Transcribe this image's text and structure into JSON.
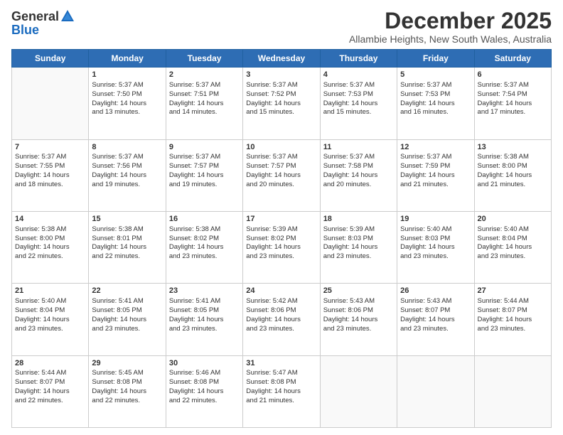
{
  "logo": {
    "general": "General",
    "blue": "Blue"
  },
  "header": {
    "month": "December 2025",
    "location": "Allambie Heights, New South Wales, Australia"
  },
  "days": [
    "Sunday",
    "Monday",
    "Tuesday",
    "Wednesday",
    "Thursday",
    "Friday",
    "Saturday"
  ],
  "weeks": [
    [
      {
        "day": "",
        "content": ""
      },
      {
        "day": "1",
        "content": "Sunrise: 5:37 AM\nSunset: 7:50 PM\nDaylight: 14 hours\nand 13 minutes."
      },
      {
        "day": "2",
        "content": "Sunrise: 5:37 AM\nSunset: 7:51 PM\nDaylight: 14 hours\nand 14 minutes."
      },
      {
        "day": "3",
        "content": "Sunrise: 5:37 AM\nSunset: 7:52 PM\nDaylight: 14 hours\nand 15 minutes."
      },
      {
        "day": "4",
        "content": "Sunrise: 5:37 AM\nSunset: 7:53 PM\nDaylight: 14 hours\nand 15 minutes."
      },
      {
        "day": "5",
        "content": "Sunrise: 5:37 AM\nSunset: 7:53 PM\nDaylight: 14 hours\nand 16 minutes."
      },
      {
        "day": "6",
        "content": "Sunrise: 5:37 AM\nSunset: 7:54 PM\nDaylight: 14 hours\nand 17 minutes."
      }
    ],
    [
      {
        "day": "7",
        "content": "Sunrise: 5:37 AM\nSunset: 7:55 PM\nDaylight: 14 hours\nand 18 minutes."
      },
      {
        "day": "8",
        "content": "Sunrise: 5:37 AM\nSunset: 7:56 PM\nDaylight: 14 hours\nand 19 minutes."
      },
      {
        "day": "9",
        "content": "Sunrise: 5:37 AM\nSunset: 7:57 PM\nDaylight: 14 hours\nand 19 minutes."
      },
      {
        "day": "10",
        "content": "Sunrise: 5:37 AM\nSunset: 7:57 PM\nDaylight: 14 hours\nand 20 minutes."
      },
      {
        "day": "11",
        "content": "Sunrise: 5:37 AM\nSunset: 7:58 PM\nDaylight: 14 hours\nand 20 minutes."
      },
      {
        "day": "12",
        "content": "Sunrise: 5:37 AM\nSunset: 7:59 PM\nDaylight: 14 hours\nand 21 minutes."
      },
      {
        "day": "13",
        "content": "Sunrise: 5:38 AM\nSunset: 8:00 PM\nDaylight: 14 hours\nand 21 minutes."
      }
    ],
    [
      {
        "day": "14",
        "content": "Sunrise: 5:38 AM\nSunset: 8:00 PM\nDaylight: 14 hours\nand 22 minutes."
      },
      {
        "day": "15",
        "content": "Sunrise: 5:38 AM\nSunset: 8:01 PM\nDaylight: 14 hours\nand 22 minutes."
      },
      {
        "day": "16",
        "content": "Sunrise: 5:38 AM\nSunset: 8:02 PM\nDaylight: 14 hours\nand 23 minutes."
      },
      {
        "day": "17",
        "content": "Sunrise: 5:39 AM\nSunset: 8:02 PM\nDaylight: 14 hours\nand 23 minutes."
      },
      {
        "day": "18",
        "content": "Sunrise: 5:39 AM\nSunset: 8:03 PM\nDaylight: 14 hours\nand 23 minutes."
      },
      {
        "day": "19",
        "content": "Sunrise: 5:40 AM\nSunset: 8:03 PM\nDaylight: 14 hours\nand 23 minutes."
      },
      {
        "day": "20",
        "content": "Sunrise: 5:40 AM\nSunset: 8:04 PM\nDaylight: 14 hours\nand 23 minutes."
      }
    ],
    [
      {
        "day": "21",
        "content": "Sunrise: 5:40 AM\nSunset: 8:04 PM\nDaylight: 14 hours\nand 23 minutes."
      },
      {
        "day": "22",
        "content": "Sunrise: 5:41 AM\nSunset: 8:05 PM\nDaylight: 14 hours\nand 23 minutes."
      },
      {
        "day": "23",
        "content": "Sunrise: 5:41 AM\nSunset: 8:05 PM\nDaylight: 14 hours\nand 23 minutes."
      },
      {
        "day": "24",
        "content": "Sunrise: 5:42 AM\nSunset: 8:06 PM\nDaylight: 14 hours\nand 23 minutes."
      },
      {
        "day": "25",
        "content": "Sunrise: 5:43 AM\nSunset: 8:06 PM\nDaylight: 14 hours\nand 23 minutes."
      },
      {
        "day": "26",
        "content": "Sunrise: 5:43 AM\nSunset: 8:07 PM\nDaylight: 14 hours\nand 23 minutes."
      },
      {
        "day": "27",
        "content": "Sunrise: 5:44 AM\nSunset: 8:07 PM\nDaylight: 14 hours\nand 23 minutes."
      }
    ],
    [
      {
        "day": "28",
        "content": "Sunrise: 5:44 AM\nSunset: 8:07 PM\nDaylight: 14 hours\nand 22 minutes."
      },
      {
        "day": "29",
        "content": "Sunrise: 5:45 AM\nSunset: 8:08 PM\nDaylight: 14 hours\nand 22 minutes."
      },
      {
        "day": "30",
        "content": "Sunrise: 5:46 AM\nSunset: 8:08 PM\nDaylight: 14 hours\nand 22 minutes."
      },
      {
        "day": "31",
        "content": "Sunrise: 5:47 AM\nSunset: 8:08 PM\nDaylight: 14 hours\nand 21 minutes."
      },
      {
        "day": "",
        "content": ""
      },
      {
        "day": "",
        "content": ""
      },
      {
        "day": "",
        "content": ""
      }
    ]
  ]
}
